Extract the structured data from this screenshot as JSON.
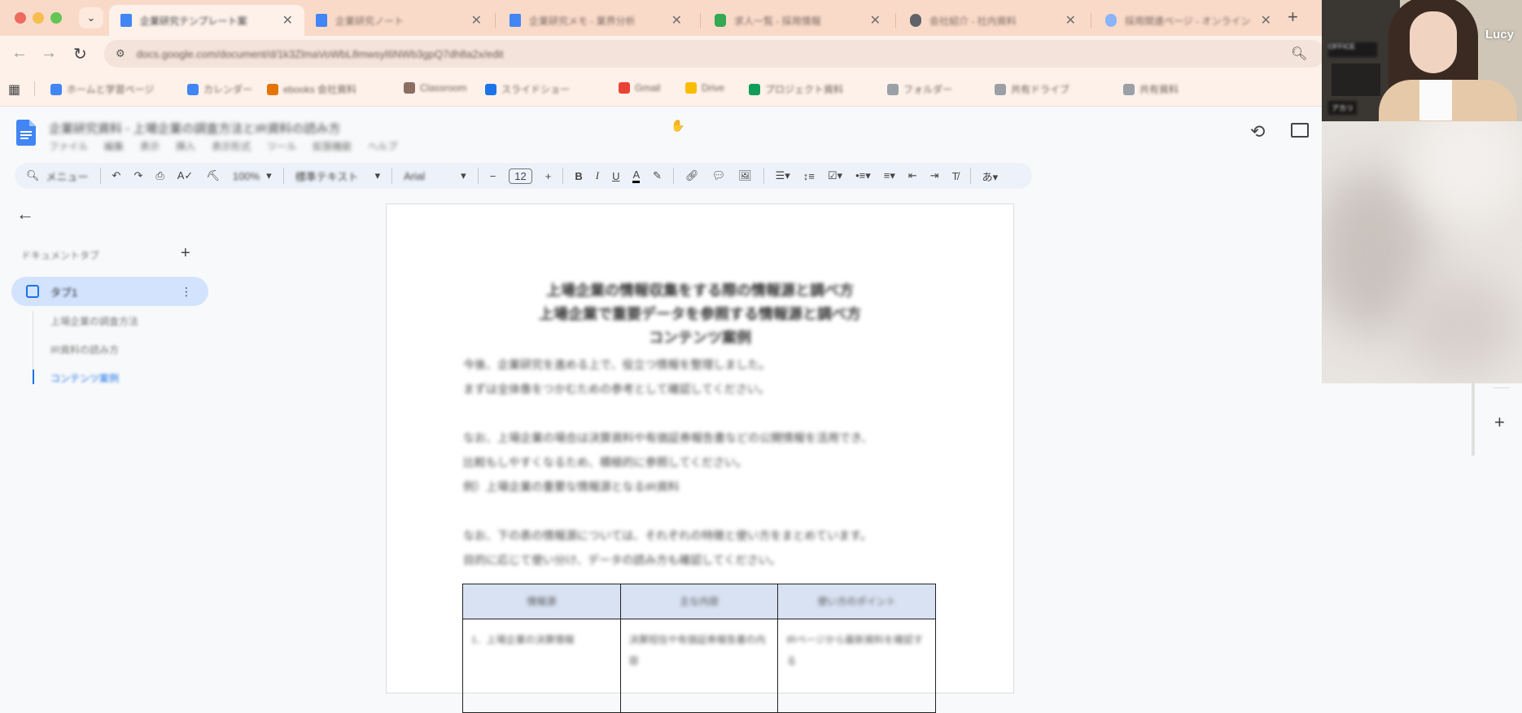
{
  "browser": {
    "tabs": [
      {
        "title": "企業研究テンプレート案",
        "favicon_color": "#4285f4",
        "active": true
      },
      {
        "title": "企業研究ノート",
        "favicon_color": "#4285f4",
        "active": false
      },
      {
        "title": "企業研究メモ - 業界分析",
        "favicon_color": "#4285f4",
        "active": false
      },
      {
        "title": "求人一覧 - 採用情報",
        "favicon_color": "#34a853",
        "active": false
      },
      {
        "title": "会社紹介 - 社内資料",
        "favicon_color": "#5f6368",
        "active": false
      },
      {
        "title": "採用関連ページ - オンライン",
        "favicon_color": "#8ab4f8",
        "active": false
      }
    ],
    "url": "docs.google.com/document/d/1k3ZlmaVoWbL8mwsyl6NWb3gpQ7dh8a2x/edit",
    "bookmarks": [
      {
        "label": "ホームと学習ページ",
        "color": "#4285f4"
      },
      {
        "label": "カレンダー",
        "color": "#4285f4"
      },
      {
        "label": "ebooks 会社資料",
        "color": "#e37400"
      },
      {
        "label": "Classroom",
        "color": "#8d6e63"
      },
      {
        "label": "スライドショー",
        "color": "#1a73e8"
      },
      {
        "label": "Gmail",
        "color": "#ea4335"
      },
      {
        "label": "Drive",
        "color": "#fbbc04"
      },
      {
        "label": "プロジェクト資料",
        "color": "#0f9d58"
      },
      {
        "label": "フォルダー",
        "color": "#9aa0a6"
      },
      {
        "label": "共有ドライブ",
        "color": "#9aa0a6"
      },
      {
        "label": "共有資料",
        "color": "#9aa0a6"
      }
    ]
  },
  "docs": {
    "title": "企業研究資料 - 上場企業の調査方法とIR資料の読み方",
    "menu": [
      "ファイル",
      "編集",
      "表示",
      "挿入",
      "表示形式",
      "ツール",
      "拡張機能",
      "ヘルプ"
    ],
    "toolbar": {
      "search": "メニュー",
      "zoom": "100%",
      "style": "標準テキスト",
      "font": "Arial",
      "font_size": "12"
    }
  },
  "outline": {
    "header": "ドキュメントタブ",
    "tab_name": "タブ1",
    "headings": [
      {
        "text": "上場企業の調査方法",
        "active": false
      },
      {
        "text": "IR資料の読み方",
        "active": false
      },
      {
        "text": "コンテンツ案例",
        "active": true
      }
    ]
  },
  "page": {
    "heading_lines": [
      "上場企業の情報収集をする際の情報源と調べ方",
      "上場企業で重要データを参照する情報源と調べ方",
      "コンテンツ案例"
    ],
    "paragraph1": [
      "今後、企業研究を進める上で、役立つ情報を整理しました。",
      "まずは全体像をつかむための参考として確認してください。"
    ],
    "paragraph2": [
      "なお、上場企業の場合は決算資料や有価証券報告書などの公開情報を活用でき、",
      "比較もしやすくなるため、積極的に参照してください。",
      "例）上場企業の重要な情報源となるIR資料"
    ],
    "paragraph3": [
      "なお、下の表の情報源については、それぞれの特徴と使い方をまとめています。",
      "目的に応じて使い分け、データの読み方も確認してください。"
    ],
    "table": {
      "headers": [
        "情報源",
        "主な内容",
        "使い方のポイント"
      ],
      "rows": [
        [
          "1．上場企業の決算情報",
          "決算短信や有価証券報告書の内容",
          "IRページから最新資料を確認する"
        ]
      ]
    }
  },
  "video": {
    "participant_name": "Lucy",
    "nameplate": "アカリ",
    "sign_text": "OFFICE"
  }
}
